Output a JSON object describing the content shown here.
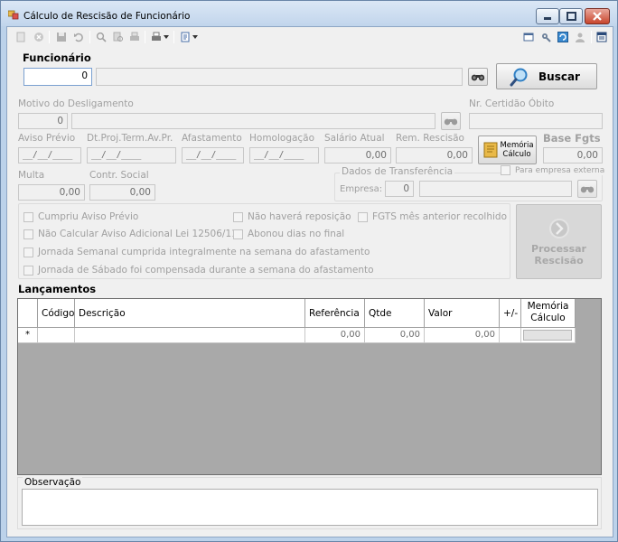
{
  "window": {
    "title": "Cálculo de Rescisão de Funcionário",
    "controls": [
      "minimize",
      "maximize",
      "close"
    ]
  },
  "toolbar": {
    "left_icons": [
      "new-icon",
      "cancel-icon",
      "save-icon",
      "undo-icon",
      "search-icon",
      "find-record-icon",
      "print-icon",
      "print-dropdown-icon",
      "report-icon"
    ],
    "right_icons": [
      "window-icon",
      "tools-icon",
      "refresh-icon",
      "user-icon",
      "exit-icon"
    ]
  },
  "funcionario": {
    "label": "Funcionário",
    "code_value": "0",
    "name_value": "",
    "search_button": "Buscar"
  },
  "desligamento": {
    "motivo_label": "Motivo do Desligamento",
    "motivo_code": "0",
    "motivo_desc": "",
    "certidao_label": "Nr. Certidão Óbito",
    "certidao_value": ""
  },
  "datas": {
    "aviso_previo_label": "Aviso Prévio",
    "aviso_previo_value": "__/__/____",
    "dt_proj_label": "Dt.Proj.Term.Av.Pr.",
    "dt_proj_value": "__/__/____",
    "afastamento_label": "Afastamento",
    "afastamento_value": "__/__/____",
    "homologacao_label": "Homologação",
    "homologacao_value": "__/__/____",
    "salario_label": "Salário Atual",
    "salario_value": "0,00",
    "rem_rescisao_label": "Rem. Rescisão",
    "rem_rescisao_value": "0,00",
    "memoria_button": "Memória Cálculo",
    "base_fgts_label": "Base Fgts",
    "base_fgts_value": "0,00"
  },
  "multa": {
    "multa_label": "Multa",
    "multa_value": "0,00",
    "contr_social_label": "Contr. Social",
    "contr_social_value": "0,00"
  },
  "transferencia": {
    "group_label": "Dados de Transferência",
    "para_empresa_externa": "Para empresa externa",
    "empresa_label": "Empresa:",
    "empresa_code": "0",
    "empresa_name": ""
  },
  "opcoes": {
    "cumpriu_aviso": "Cumpriu Aviso Prévio",
    "nao_havera_reposicao": "Não haverá reposição",
    "fgts_mes_anterior": "FGTS mês anterior recolhido",
    "nao_calcular_aviso": "Não Calcular Aviso Adicional Lei 12506/11",
    "abonou_dias": "Abonou dias no final",
    "jornada_semanal": "Jornada Semanal cumprida integralmente na semana do afastamento",
    "jornada_sabado": "Jornada de Sábado foi compensada durante a semana do afastamento",
    "processar_button": "Processar Rescisão"
  },
  "lancamentos": {
    "label": "Lançamentos",
    "columns": [
      "Código",
      "Descrição",
      "Referência",
      "Qtde",
      "Valor",
      "+/-",
      "Memória Cálculo"
    ],
    "rows": [
      {
        "codigo": "",
        "descricao": "",
        "referencia": "0,00",
        "qtde": "0,00",
        "valor": "0,00",
        "sinal": "",
        "memoria": ""
      }
    ],
    "new_row_marker": "*"
  },
  "observacao": {
    "label": "Observação",
    "value": ""
  }
}
